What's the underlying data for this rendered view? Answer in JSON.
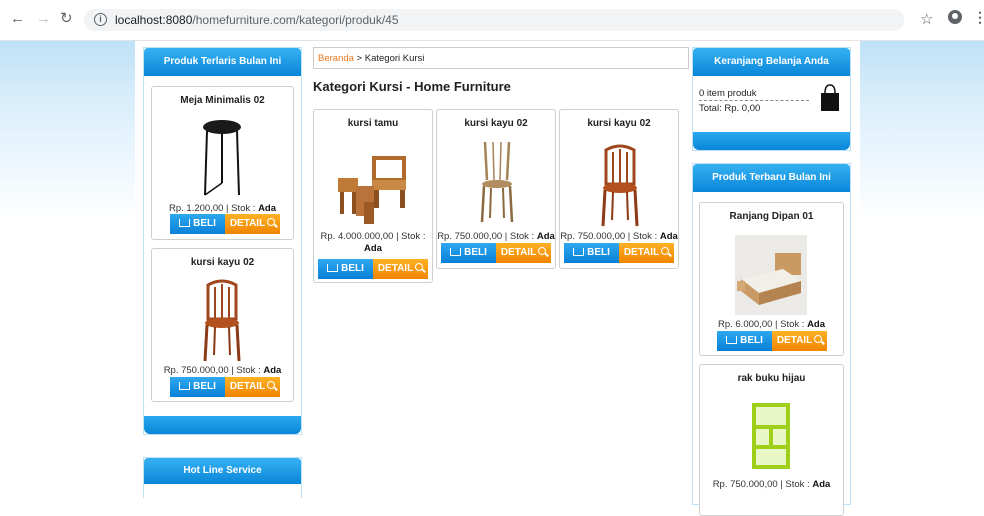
{
  "browser": {
    "url_host": "localhost:8080",
    "url_path": "/homefurniture.com/kategori/produk/45"
  },
  "left": {
    "bestseller_title": "Produk Terlaris Bulan Ini",
    "products": [
      {
        "name": "Meja Minimalis 02",
        "price": "Rp. 1.200,00 | Stok : ",
        "stock": "Ada"
      },
      {
        "name": "kursi kayu 02",
        "price": "Rp. 750.000,00 | Stok : ",
        "stock": "Ada"
      }
    ],
    "hotline_title": "Hot Line Service"
  },
  "main": {
    "breadcrumb_home": "Beranda",
    "breadcrumb_current": " > Kategori Kursi",
    "title": "Kategori Kursi - Home Furniture",
    "products": [
      {
        "name": "kursi tamu",
        "price": "Rp. 4.000.000,00 | Stok : ",
        "stock": "Ada"
      },
      {
        "name": "kursi kayu 02",
        "price": "Rp. 750.000,00 | Stok : ",
        "stock": "Ada"
      },
      {
        "name": "kursi kayu 02",
        "price": "Rp. 750.000,00 | Stok : ",
        "stock": "Ada"
      }
    ]
  },
  "right": {
    "cart_title": "Keranjang Belanja Anda",
    "cart_items": "0 item produk",
    "cart_total": "Total: Rp. 0,00",
    "newest_title": "Produk Terbaru Bulan Ini",
    "products": [
      {
        "name": "Ranjang Dipan 01",
        "price": "Rp. 6.000,00 | Stok : ",
        "stock": "Ada"
      },
      {
        "name": "rak buku hijau",
        "price": "Rp. 750.000,00 | Stok : ",
        "stock": "Ada"
      }
    ]
  },
  "buttons": {
    "beli": "BELI",
    "detail": "DETAIL"
  }
}
